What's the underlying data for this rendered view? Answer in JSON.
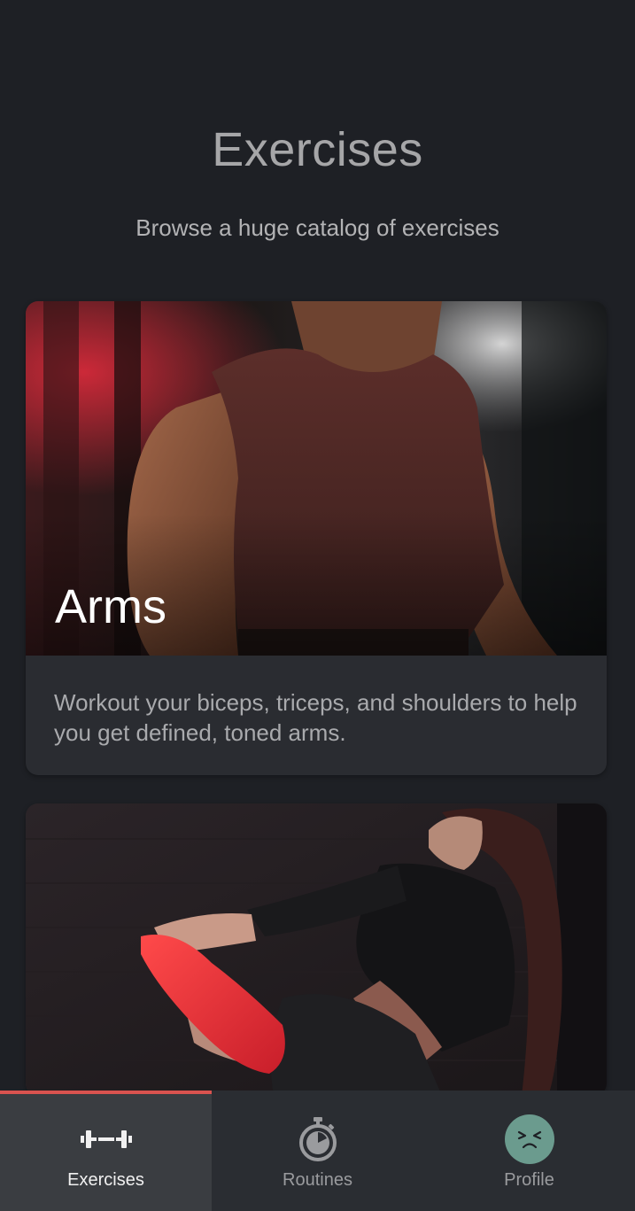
{
  "header": {
    "title": "Exercises",
    "subtitle": "Browse a huge catalog of exercises"
  },
  "cards": [
    {
      "label": "Arms",
      "description": "Workout your biceps, triceps, and shoulders to help you get defined, toned arms."
    },
    {
      "label": "",
      "description": ""
    }
  ],
  "nav": {
    "items": [
      {
        "label": "Exercises",
        "icon": "dumbbell-icon",
        "active": true
      },
      {
        "label": "Routines",
        "icon": "stopwatch-icon",
        "active": false
      },
      {
        "label": "Profile",
        "icon": "avatar-icon",
        "active": false
      }
    ]
  },
  "colors": {
    "background": "#1e2025",
    "card": "#2a2c31",
    "nav_active_indicator": "#d9534f",
    "avatar": "#6b9b8e"
  }
}
